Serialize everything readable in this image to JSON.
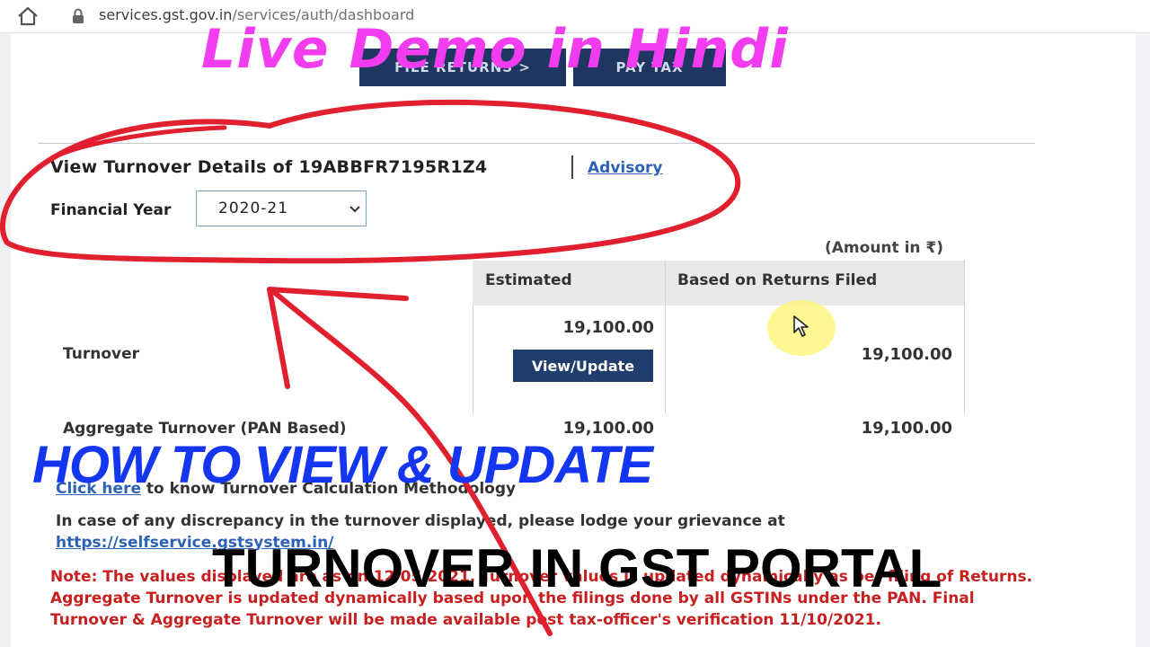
{
  "browser": {
    "url_host": "services.gst.gov.in",
    "url_path": "/services/auth/dashboard"
  },
  "top_buttons": [
    {
      "label": "FILE RETURNS >"
    },
    {
      "label": "PAY TAX"
    }
  ],
  "turnover": {
    "title": "View Turnover Details of 19ABBFR7195R1Z4",
    "advisory_link": "Advisory",
    "fy_label": "Financial Year",
    "fy_selected": "2020-21",
    "amount_note": "(Amount in ₹)",
    "col_estimated": "Estimated",
    "col_returns": "Based on Returns Filed",
    "rows": [
      {
        "label": "Turnover",
        "estimated": "19,100.00",
        "returns": "19,100.00"
      },
      {
        "label": "Aggregate Turnover (PAN Based)",
        "estimated": "19,100.00",
        "returns": "19,100.00"
      }
    ],
    "view_update_button": "View/Update",
    "click_here_link": "Click here",
    "click_here_text": " to know Turnover Calculation Methodology",
    "discrepancy_text": "In case of any discrepancy in the turnover displayed, please lodge your grievance at",
    "selfservice_link": "https://selfservice.gstsystem.in/",
    "note_text": "Note: The values displayed are as on 12/05/2021. Turnover values is updated dynamically as per filing of Returns. Aggregate Turnover is updated dynamically based upon the filings done by all GSTINs under the PAN. Final Turnover & Aggregate Turnover will be made available post tax-officer's verification 11/10/2021."
  },
  "overlay": {
    "live_demo": "Live Demo in Hindi",
    "how_to": "HOW TO VIEW & UPDATE",
    "turnover_portal": "TURNOVER IN GST PORTAL"
  },
  "colors": {
    "live_demo": "#f23cf0",
    "how_to": "#1436f0",
    "annotation_red": "#e0202e",
    "note_red": "#c62020",
    "gst_navy": "#1f3760"
  }
}
